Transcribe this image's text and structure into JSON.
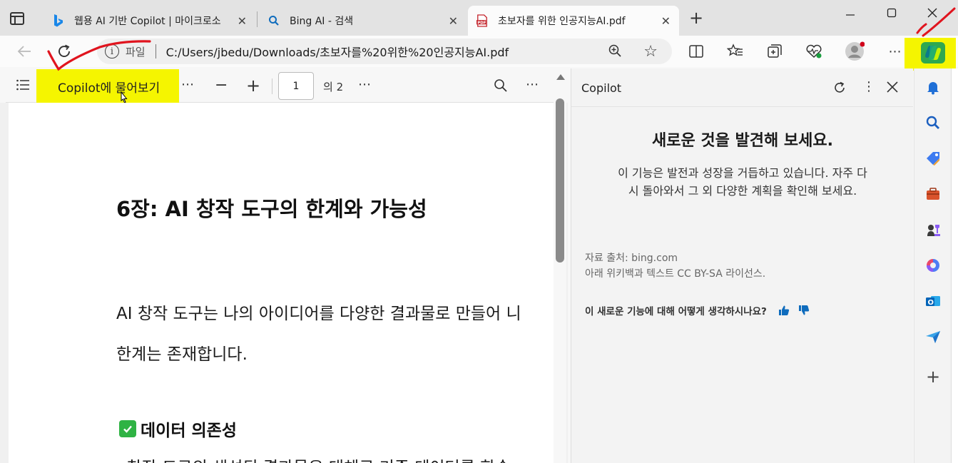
{
  "tabs": [
    {
      "title": "웹용 AI 기반 Copilot | 마이크로소",
      "favicon": "bing-icon"
    },
    {
      "title": "Bing AI - 검색",
      "favicon": "search-icon"
    },
    {
      "title": "초보자를 위한 인공지능AI.pdf",
      "favicon": "pdf-icon",
      "active": true
    }
  ],
  "address": {
    "scheme": "파일",
    "url": "C:/Users/jbedu/Downloads/초보자를%20위한%20인공지능AI.pdf"
  },
  "pdf_toolbar": {
    "ask_copilot": "Copilot에 물어보기",
    "page_current": "1",
    "page_total": "의 2"
  },
  "document": {
    "heading": "6장: AI 창작 도구의 한계와 가능성",
    "para_line1": "AI 창작 도구는 나의 아이디어를 다양한 결과물로 만들어 니",
    "para_line2": "한계는 존재합니다.",
    "subheading": "데이터 의존성",
    "cut_line": "· 창작 도구의 생성된 결과물은 대체로 기존 데이터를 학습"
  },
  "copilot_pane": {
    "title": "Copilot",
    "heading": "새로운 것을 발견해 보세요.",
    "desc": "이 기능은 발전과 성장을 거듭하고 있습니다. 자주 다시 돌아와서 그 외 다양한 계획을 확인해 보세요.",
    "source_line1": "자료 출처: bing.com",
    "source_line2": "아래 위키백과 텍스트 CC BY-SA 라이선스.",
    "feedback_question": "이 새로운 기능에 대해 어떻게 생각하시나요?"
  },
  "colors": {
    "highlight": "#f5f500",
    "annotation": "#e0141e",
    "accent": "#0f6cbd"
  }
}
